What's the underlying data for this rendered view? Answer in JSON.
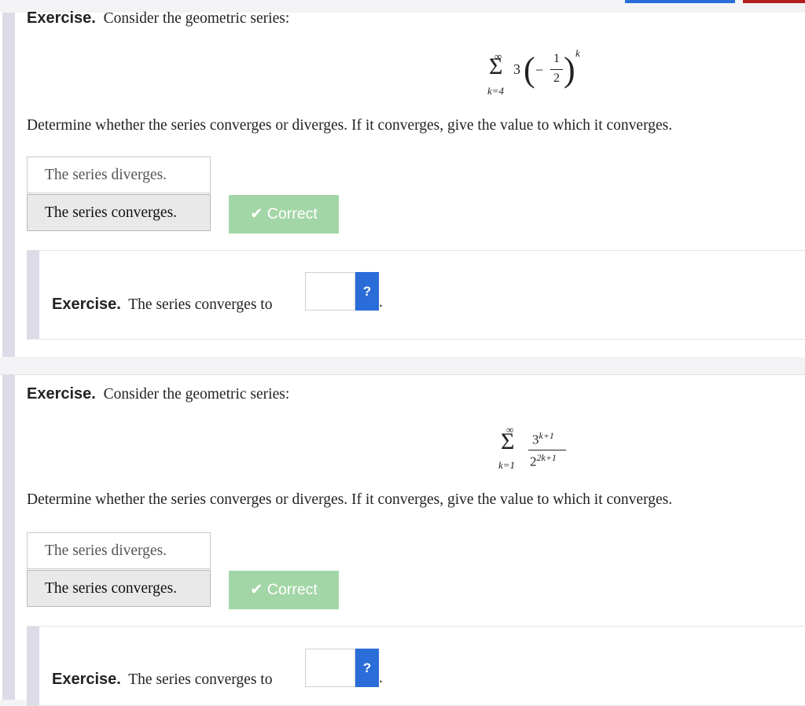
{
  "exercises": [
    {
      "label": "Exercise.",
      "intro": "Consider the geometric series:",
      "math": {
        "sum_upper": "∞",
        "sum_lower": "k=4",
        "coef": "3",
        "neg": "−",
        "num": "1",
        "den": "2",
        "exp": "k"
      },
      "question": "Determine whether the series converges or diverges. If it converges, give the value to which it converges.",
      "options": [
        "The series diverges.",
        "The series converges."
      ],
      "selected_index": 1,
      "feedback": "Correct",
      "sub": {
        "label": "Exercise.",
        "text": "The series converges to",
        "help": "?",
        "input_value": "",
        "period": "."
      }
    },
    {
      "label": "Exercise.",
      "intro": "Consider the geometric series:",
      "math": {
        "sum_upper": "∞",
        "sum_lower": "k=1",
        "num_base": "3",
        "num_exp": "k+1",
        "den_base": "2",
        "den_exp": "2k+1"
      },
      "question": "Determine whether the series converges or diverges. If it converges, give the value to which it converges.",
      "options": [
        "The series diverges.",
        "The series converges."
      ],
      "selected_index": 1,
      "feedback": "Correct",
      "sub": {
        "label": "Exercise.",
        "text": "The series converges to",
        "help": "?",
        "input_value": "",
        "period": "."
      }
    }
  ],
  "colors": {
    "accent": "#2a6dd9",
    "correct": "#a3d6a6",
    "danger": "#b01e1e"
  }
}
